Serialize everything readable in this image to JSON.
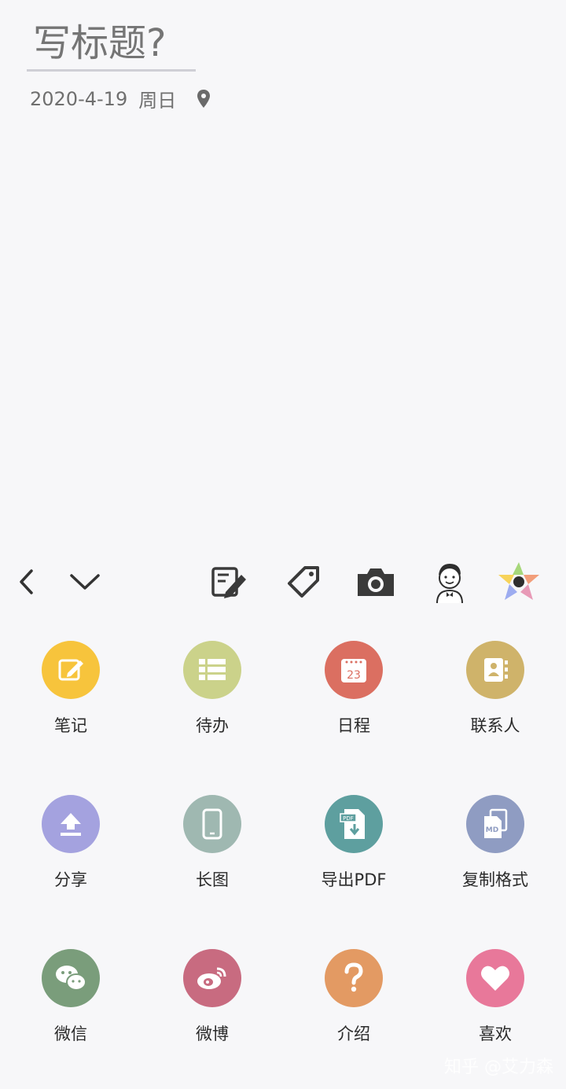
{
  "header": {
    "title_placeholder": "写标题?",
    "date": "2020-4-19",
    "weekday": "周日",
    "pin_icon": "location-pin-icon"
  },
  "toolbar": {
    "back_icon": "chevron-left-icon",
    "collapse_icon": "chevron-down-icon",
    "items": [
      {
        "icon": "edit-notes-icon"
      },
      {
        "icon": "tag-icon"
      },
      {
        "icon": "camera-icon"
      },
      {
        "icon": "avatar-icon"
      },
      {
        "icon": "color-star-icon"
      }
    ]
  },
  "grid": {
    "items": [
      {
        "label": "笔记",
        "icon": "edit-icon",
        "color": "#f7c43c"
      },
      {
        "label": "待办",
        "icon": "list-icon",
        "color": "#cbd28a"
      },
      {
        "label": "日程",
        "icon": "calendar-icon",
        "color": "#db6f61"
      },
      {
        "label": "联系人",
        "icon": "contact-card-icon",
        "color": "#cfb36a"
      },
      {
        "label": "分享",
        "icon": "upload-icon",
        "color": "#a4a2df"
      },
      {
        "label": "长图",
        "icon": "phone-icon",
        "color": "#9fb8b1"
      },
      {
        "label": "导出PDF",
        "icon": "pdf-export-icon",
        "color": "#5e9f9f"
      },
      {
        "label": "复制格式",
        "icon": "markdown-copy-icon",
        "color": "#8f9cc2"
      },
      {
        "label": "微信",
        "icon": "wechat-icon",
        "color": "#7a9d7b"
      },
      {
        "label": "微博",
        "icon": "weibo-icon",
        "color": "#c86b80"
      },
      {
        "label": "介绍",
        "icon": "question-icon",
        "color": "#e39a63"
      },
      {
        "label": "喜欢",
        "icon": "heart-icon",
        "color": "#e8789a"
      }
    ],
    "calendar_day": "23",
    "markdown_badge": "MD",
    "pdf_badge": "PDF"
  },
  "watermark": "知乎 @艾力森"
}
